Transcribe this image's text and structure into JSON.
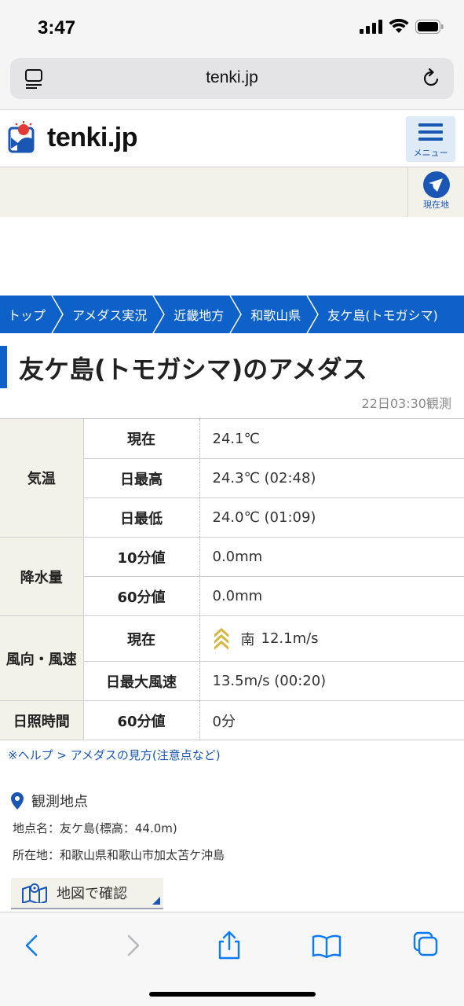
{
  "status": {
    "time": "3:47"
  },
  "browser": {
    "url": "tenki.jp"
  },
  "site": {
    "logo_text": "tenki.jp",
    "menu_label": "メニュー",
    "location_label": "現在地"
  },
  "breadcrumb": [
    "トップ",
    "アメダス実況",
    "近畿地方",
    "和歌山県",
    "友ケ島(トモガシマ)"
  ],
  "page": {
    "title": "友ケ島(トモガシマ)のアメダス",
    "observed_at": "22日03:30観測"
  },
  "table": {
    "temperature": {
      "label": "気温",
      "rows": [
        {
          "label": "現在",
          "value": "24.1℃"
        },
        {
          "label": "日最高",
          "value": "24.3℃ (02:48)"
        },
        {
          "label": "日最低",
          "value": "24.0℃ (01:09)"
        }
      ]
    },
    "precipitation": {
      "label": "降水量",
      "rows": [
        {
          "label": "10分値",
          "value": "0.0mm"
        },
        {
          "label": "60分値",
          "value": "0.0mm"
        }
      ]
    },
    "wind": {
      "label": "風向・風速",
      "rows": [
        {
          "label": "現在",
          "direction": "南",
          "value": "12.1m/s"
        },
        {
          "label": "日最大風速",
          "value": "13.5m/s (00:20)"
        }
      ]
    },
    "sunshine": {
      "label": "日照時間",
      "rows": [
        {
          "label": "60分値",
          "value": "0分"
        }
      ]
    }
  },
  "help_link": "※ヘルプ > アメダスの見方(注意点など)",
  "station": {
    "heading": "観測地点",
    "name_line": "地点名：友ケ島(標高：44.0m)",
    "address_line": "所在地：和歌山県和歌山市加太苫ケ沖島"
  },
  "map_button": "地図で確認",
  "colors": {
    "brand_blue": "#0d61c8",
    "link_blue": "#1a57b4",
    "table_shade": "#f2f1ea",
    "wind_arrow": "#d9b640"
  }
}
